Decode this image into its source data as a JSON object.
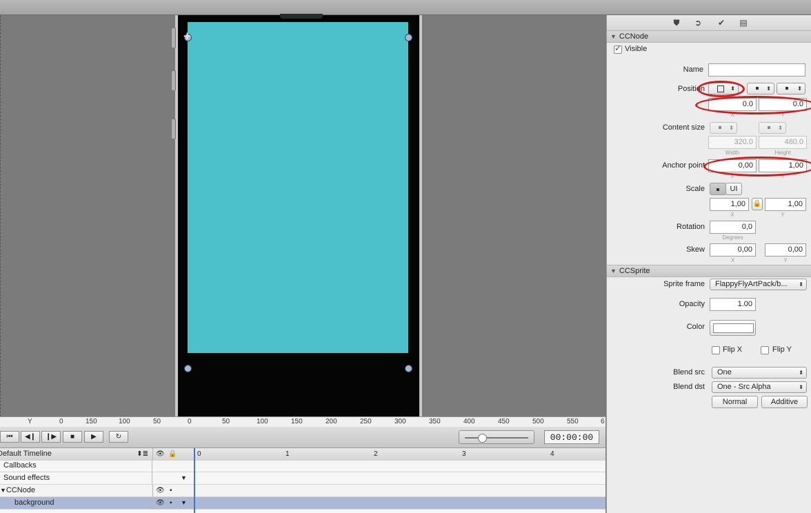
{
  "canvas": {
    "screen_color": "#4dc1cb"
  },
  "inspector": {
    "tabs": [
      "node-props-icon",
      "code-connections-icon",
      "physics-icon",
      "templates-icon"
    ],
    "ccnode": {
      "header": "CCNode",
      "visible_label": "Visible",
      "visible_checked": true,
      "name_label": "Name",
      "name_value": "",
      "position_label": "Position",
      "position_x": "0.0",
      "position_y": "0.0",
      "x_sub": "X",
      "y_sub": "Y",
      "content_size_label": "Content size",
      "content_w": "320.0",
      "content_h": "480.0",
      "width_sub": "Width",
      "height_sub": "Height",
      "anchor_label": "Anchor point",
      "anchor_x": "0,00",
      "anchor_y": "1,00",
      "scale_label": "Scale",
      "scale_ui": "UI",
      "scale_x": "1,00",
      "scale_y": "1,00",
      "rotation_label": "Rotation",
      "rotation_value": "0,0",
      "degrees_sub": "Degrees",
      "skew_label": "Skew",
      "skew_x": "0,00",
      "skew_y": "0,00"
    },
    "ccsprite": {
      "header": "CCSprite",
      "sprite_frame_label": "Sprite frame",
      "sprite_frame_value": "FlappyFlyArtPack/b...",
      "opacity_label": "Opacity",
      "opacity_value": "1.00",
      "color_label": "Color",
      "color_value": "#ffffff",
      "flip_x_label": "Flip X",
      "flip_y_label": "Flip Y",
      "blend_src_label": "Blend src",
      "blend_src_value": "One",
      "blend_dst_label": "Blend dst",
      "blend_dst_value": "One - Src Alpha",
      "normal_label": "Normal",
      "additive_label": "Additive"
    }
  },
  "ruler": {
    "axis_label": "Y",
    "ticks": [
      "0",
      "150",
      "100",
      "50",
      "0",
      "50",
      "100",
      "150",
      "200",
      "250",
      "300",
      "350",
      "400",
      "450",
      "500",
      "550",
      "6"
    ]
  },
  "transport": {
    "timecode": "00:00:00",
    "scrub_position": 0.26
  },
  "timeline": {
    "title": "Default Timeline",
    "rows": [
      {
        "label": "Callbacks"
      },
      {
        "label": "Sound effects"
      },
      {
        "label": "CCNode"
      },
      {
        "label": "background"
      }
    ],
    "time_marks": [
      "0",
      "1",
      "2",
      "3",
      "4"
    ]
  }
}
